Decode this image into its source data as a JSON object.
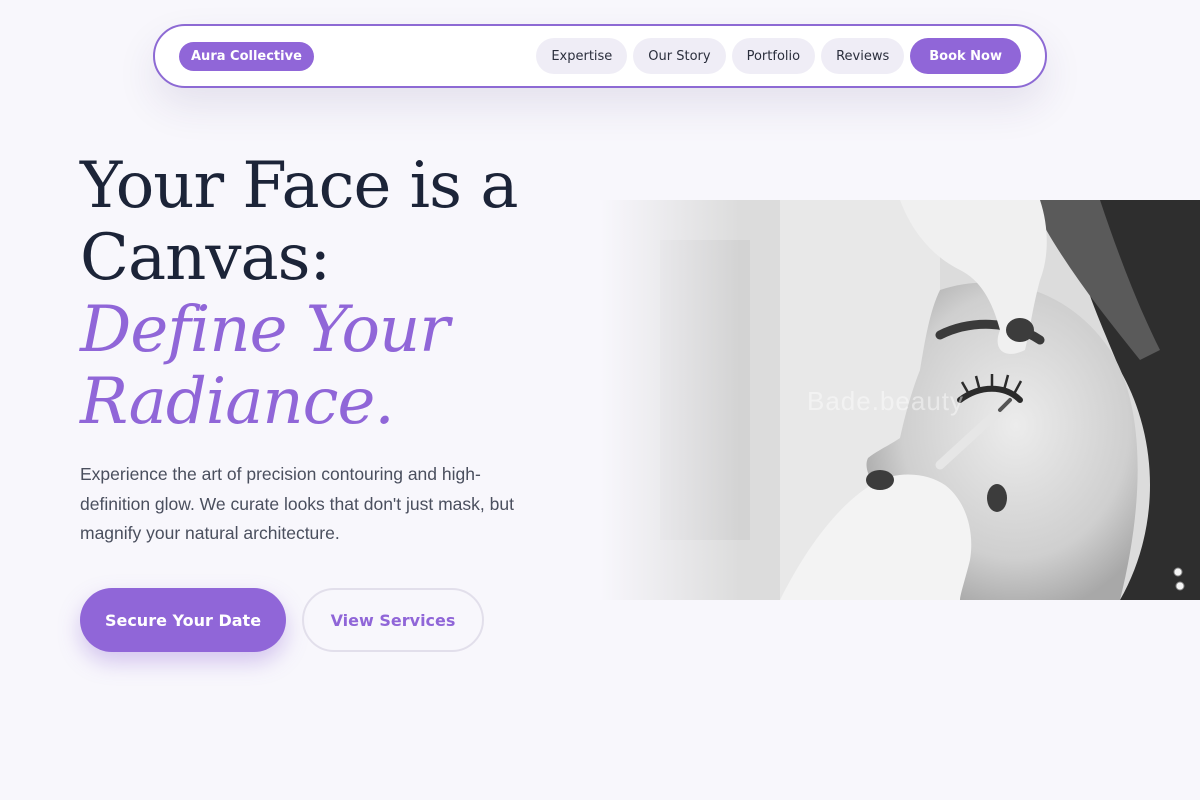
{
  "nav": {
    "brand": "Aura Collective",
    "links": [
      "Expertise",
      "Our Story",
      "Portfolio",
      "Reviews"
    ],
    "cta": "Book Now"
  },
  "hero": {
    "title_line1": "Your Face is a",
    "title_line2": "Canvas:",
    "accent_line1": "Define Your",
    "accent_line2": "Radiance.",
    "description": "Experience the art of precision contouring and high-definition glow. We curate looks that don't just mask, but magnify your natural architecture.",
    "primary_button": "Secure Your Date",
    "secondary_button": "View Services",
    "image_watermark": "Bade.beauty"
  },
  "colors": {
    "accent": "#9066d8",
    "heading": "#1c2438",
    "body_text": "#4a4f5e",
    "background": "#f8f7fc"
  }
}
